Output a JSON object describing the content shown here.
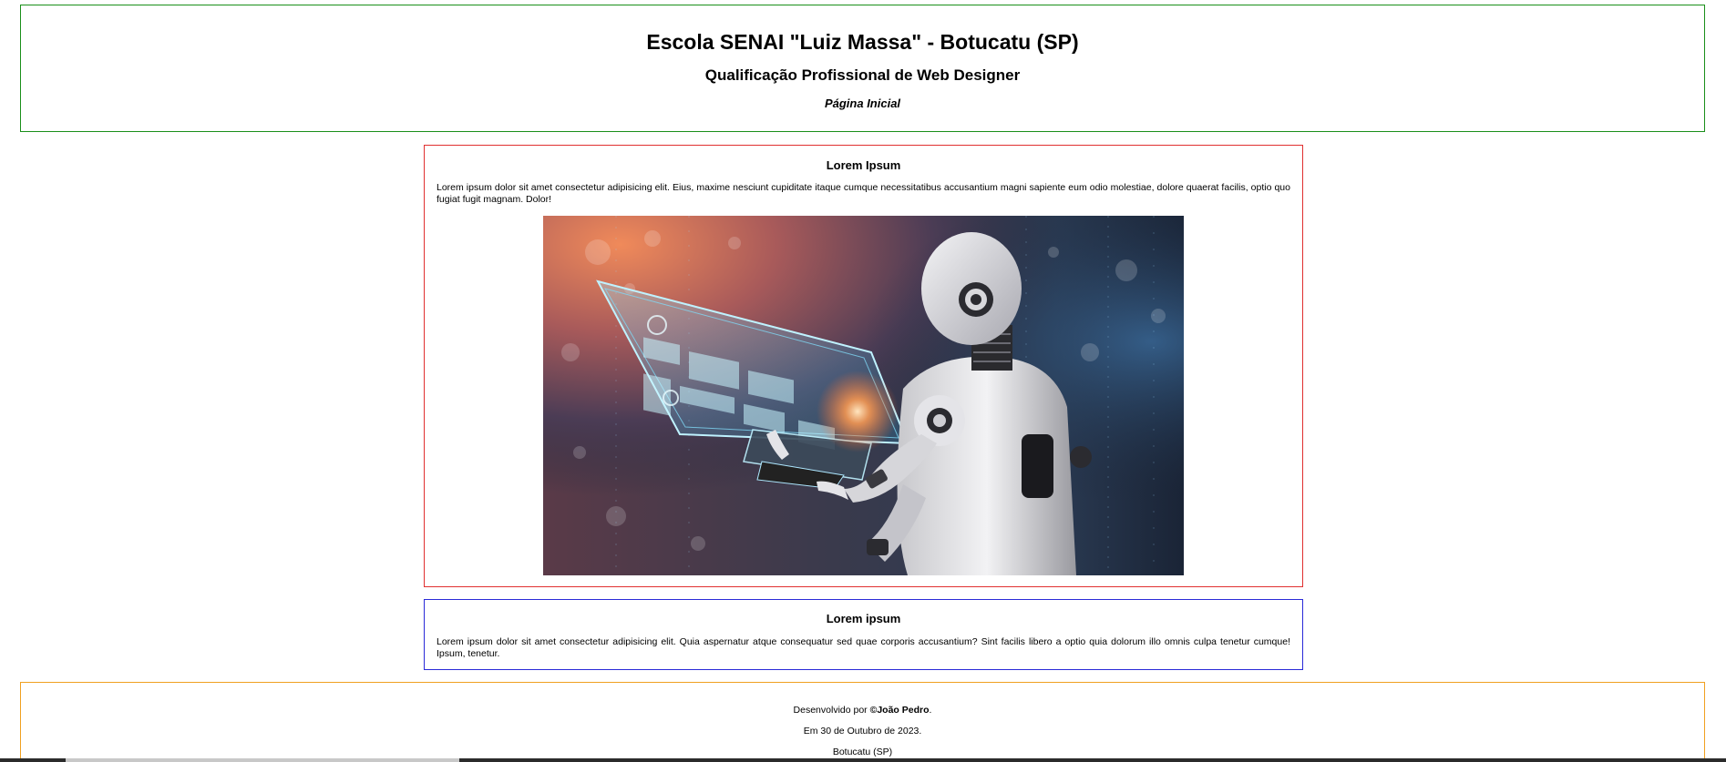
{
  "header": {
    "title": "Escola SENAI \"Luiz Massa\" - Botucatu (SP)",
    "subtitle": "Qualificação Profissional de Web Designer",
    "page_name": "Página Inicial"
  },
  "article_one": {
    "heading": "Lorem Ipsum",
    "text": "Lorem ipsum dolor sit amet consectetur adipisicing elit. Eius, maxime nesciunt cupiditate itaque cumque necessitatibus accusantium magni sapiente eum odio molestiae, dolore quaerat facilis, optio quo fugiat fugit magnam. Dolor!",
    "image": {
      "icon": "robot-holographic-screen-image"
    }
  },
  "article_two": {
    "heading": "Lorem ipsum",
    "text": "Lorem ipsum dolor sit amet consectetur adipisicing elit. Quia aspernatur atque consequatur sed quae corporis accusantium? Sint facilis libero a optio quia dolorum illo omnis culpa tenetur cumque! Ipsum, tenetur."
  },
  "footer": {
    "credit_prefix": "Desenvolvido por ",
    "credit_author": "©João Pedro",
    "credit_suffix": ".",
    "date": "Em 30 de Outubro de 2023.",
    "city": "Botucatu (SP)"
  },
  "colors": {
    "header_border": "#1a8f1a",
    "article_one_border": "#e03030",
    "article_two_border": "#2a2ad8",
    "footer_border": "#f0a020"
  }
}
